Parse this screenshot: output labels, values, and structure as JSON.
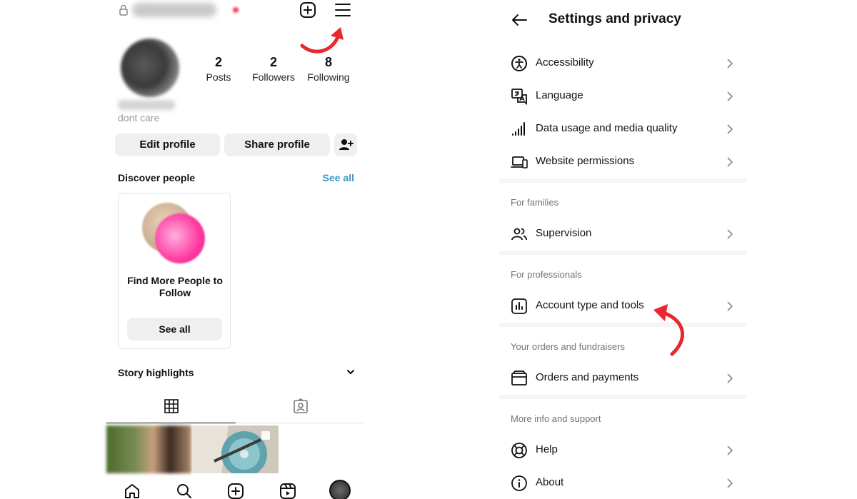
{
  "profile": {
    "stats": [
      {
        "num": "2",
        "label": "Posts"
      },
      {
        "num": "2",
        "label": "Followers"
      },
      {
        "num": "8",
        "label": "Following"
      }
    ],
    "bio": "dont care",
    "edit_label": "Edit profile",
    "share_label": "Share profile",
    "discover_title": "Discover people",
    "discover_see_all": "See all",
    "card_text": "Find More People to Follow",
    "card_button": "See all",
    "highlights": "Story highlights"
  },
  "settings": {
    "title": "Settings and privacy",
    "rows": [
      {
        "label": "Accessibility",
        "icon": "accessibility-icon"
      },
      {
        "label": "Language",
        "icon": "language-icon"
      },
      {
        "label": "Data usage and media quality",
        "icon": "signal-icon"
      },
      {
        "label": "Website permissions",
        "icon": "devices-icon"
      }
    ],
    "sections": {
      "families": "For families",
      "professionals": "For professionals",
      "orders": "Your orders and fundraisers",
      "support": "More info and support"
    },
    "supervision": "Supervision",
    "account_tools": "Account type and tools",
    "orders_payments": "Orders and payments",
    "help": "Help",
    "about": "About"
  },
  "colors": {
    "accent_link": "#3797c0",
    "annotation_arrow": "#e8272e",
    "button_bg": "#efefef"
  }
}
